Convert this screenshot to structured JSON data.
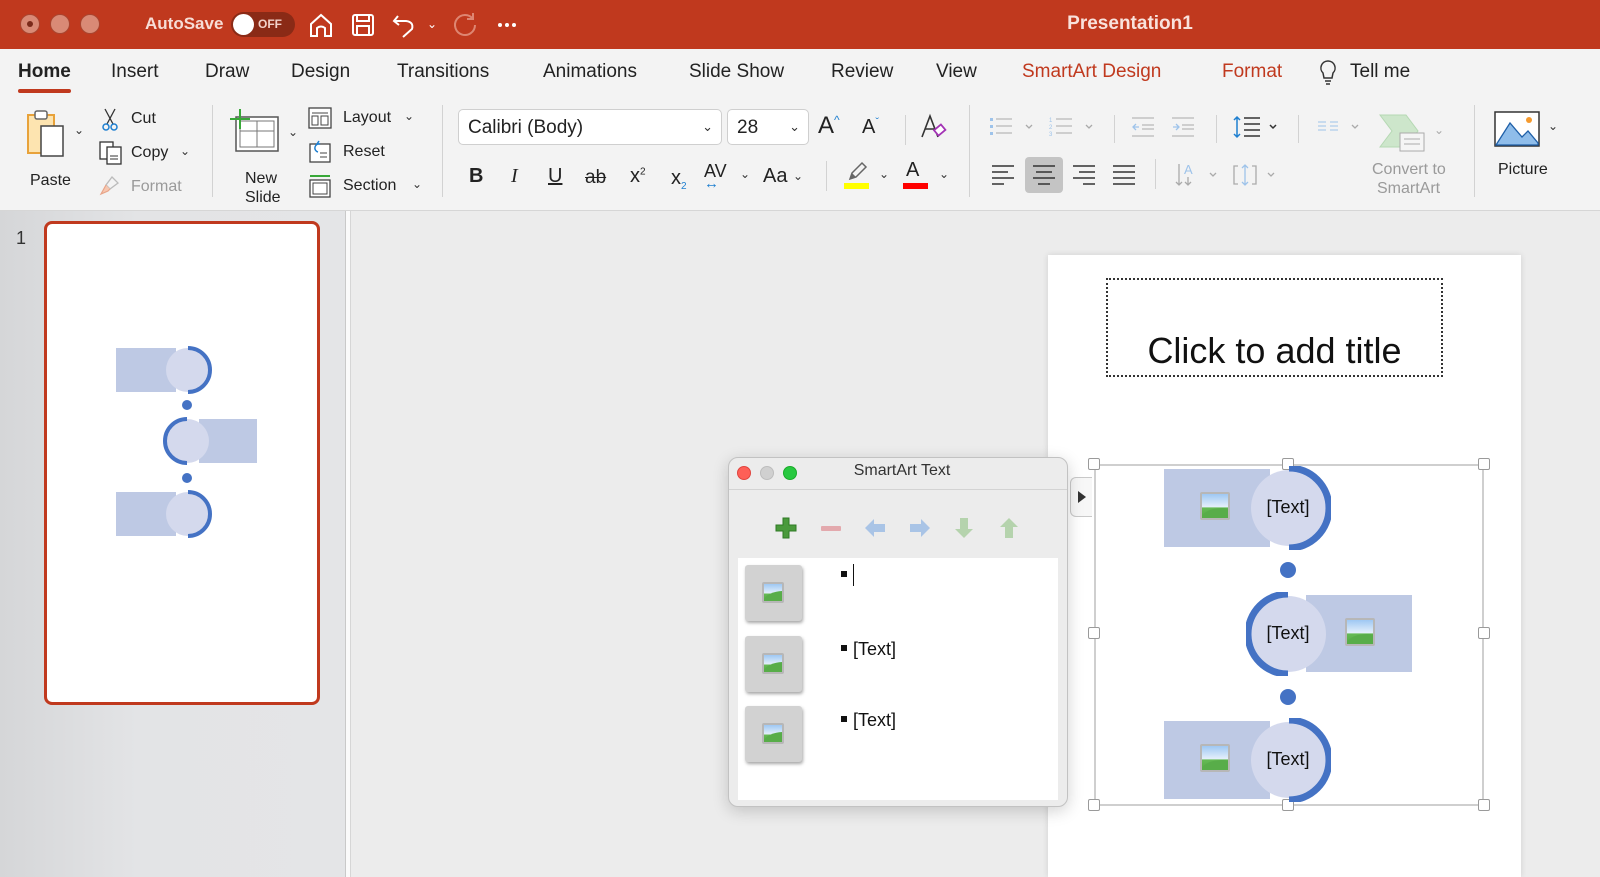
{
  "window": {
    "title": "Presentation1",
    "autosave_label": "AutoSave",
    "autosave_state": "OFF"
  },
  "titlebar_icons": [
    "home-icon",
    "save-icon",
    "undo-icon",
    "undo-dropdown-icon",
    "redo-icon",
    "more-icon"
  ],
  "tabs": [
    {
      "label": "Home",
      "active": true
    },
    {
      "label": "Insert"
    },
    {
      "label": "Draw"
    },
    {
      "label": "Design"
    },
    {
      "label": "Transitions"
    },
    {
      "label": "Animations"
    },
    {
      "label": "Slide Show"
    },
    {
      "label": "Review"
    },
    {
      "label": "View"
    },
    {
      "label": "SmartArt Design",
      "contextual": true
    },
    {
      "label": "Format",
      "contextual": true
    },
    {
      "label": "Tell me",
      "icon": "lightbulb-icon"
    }
  ],
  "ribbon": {
    "clipboard": {
      "paste": "Paste",
      "cut": "Cut",
      "copy": "Copy",
      "format": "Format"
    },
    "slides": {
      "new_slide_line1": "New",
      "new_slide_line2": "Slide",
      "layout": "Layout",
      "reset": "Reset",
      "section": "Section"
    },
    "font": {
      "font_name": "Calibri (Body)",
      "font_size": "28",
      "bold": "B",
      "italic": "I",
      "underline": "U",
      "strikethrough": "ab",
      "superscript": "x²",
      "subscript": "x₂",
      "char_spacing": "AV",
      "change_case": "Aa",
      "highlight_color": "#ffff00",
      "font_color": "#ff0000"
    },
    "paragraph": {
      "align_selected": "center"
    },
    "convert_line1": "Convert to",
    "convert_line2": "SmartArt",
    "picture": "Picture"
  },
  "slides_pane": {
    "slide_number": "1"
  },
  "slide": {
    "title_placeholder": "Click to add title",
    "smartart_items": [
      {
        "text": "[Text]"
      },
      {
        "text": "[Text]"
      },
      {
        "text": "[Text]"
      }
    ]
  },
  "smartart_text_pane": {
    "title": "SmartArt Text",
    "toolbar": [
      "add-icon",
      "remove-icon",
      "promote-icon",
      "demote-icon",
      "move-down-icon",
      "move-up-icon"
    ],
    "items": [
      {
        "text": "",
        "editing": true
      },
      {
        "text": "[Text]"
      },
      {
        "text": "[Text]"
      }
    ]
  },
  "colors": {
    "brand": "#c0391e",
    "smartart_accent": "#4472c4",
    "smartart_fill": "#bec9e4"
  }
}
